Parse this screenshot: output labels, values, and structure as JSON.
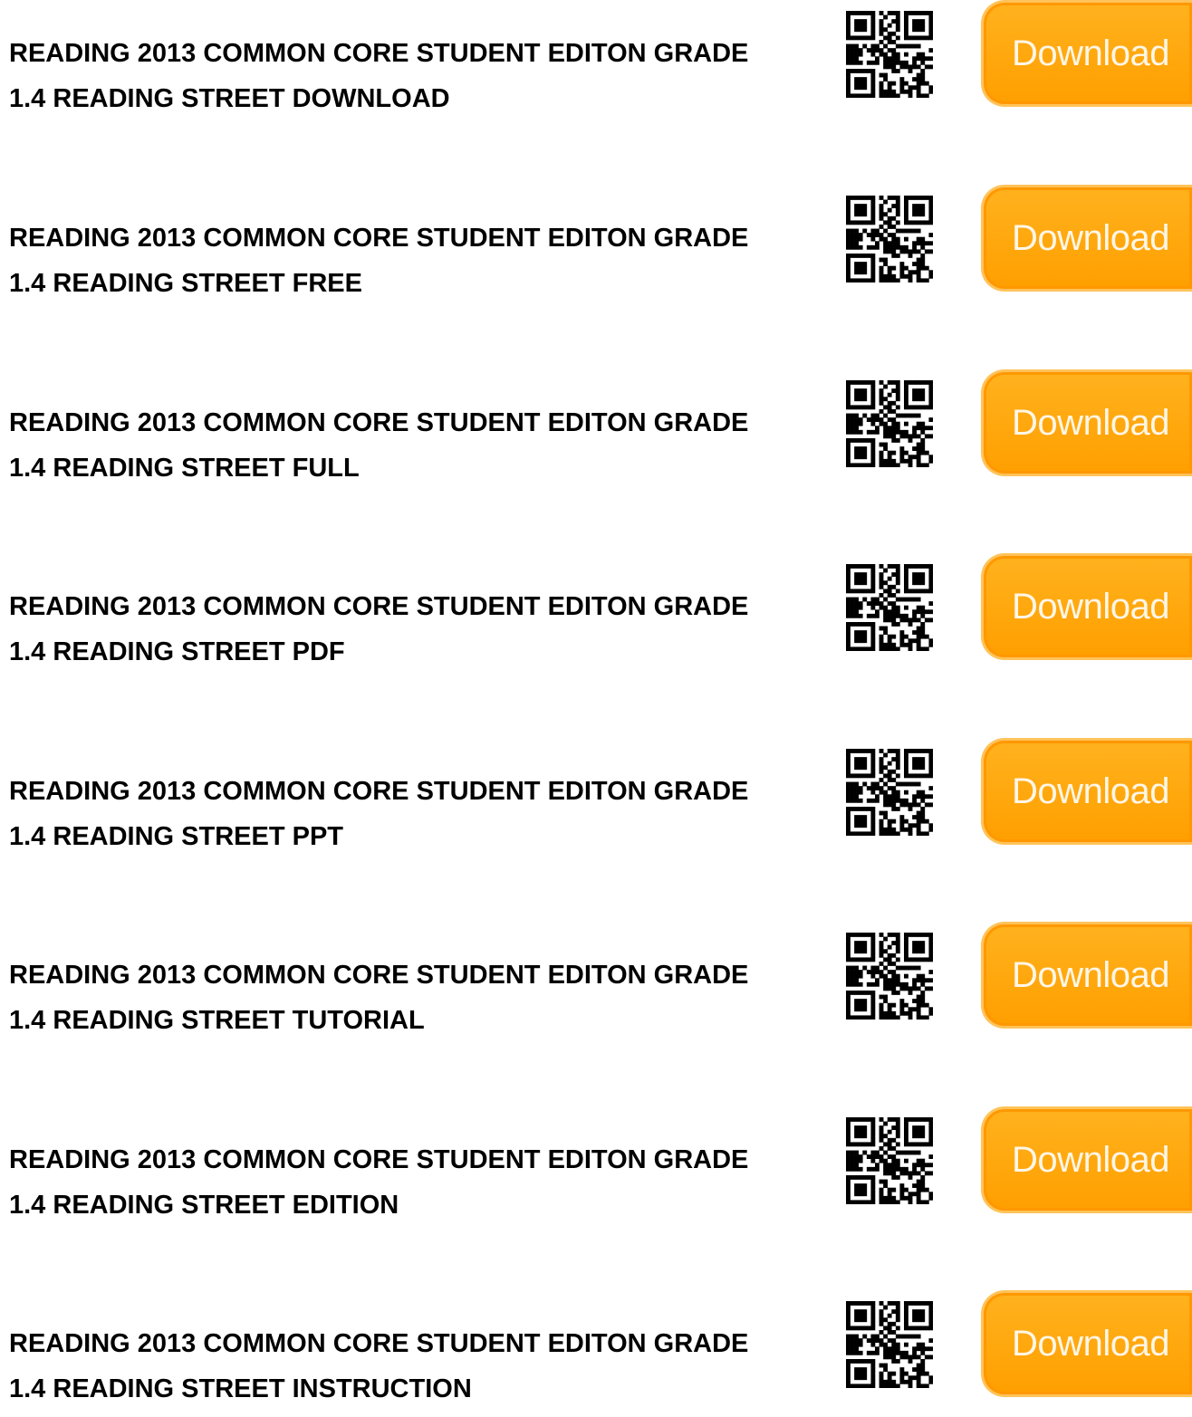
{
  "entries": [
    {
      "line1": "READING 2013 COMMON CORE STUDENT EDITON GRADE",
      "line2": "1.4 READING STREET DOWNLOAD",
      "button": "Download"
    },
    {
      "line1": "READING 2013 COMMON CORE STUDENT EDITON GRADE",
      "line2": "1.4 READING STREET FREE",
      "button": "Download"
    },
    {
      "line1": "READING 2013 COMMON CORE STUDENT EDITON GRADE",
      "line2": "1.4 READING STREET FULL",
      "button": "Download"
    },
    {
      "line1": "READING 2013 COMMON CORE STUDENT EDITON GRADE",
      "line2": "1.4 READING STREET PDF",
      "button": "Download"
    },
    {
      "line1": "READING 2013 COMMON CORE STUDENT EDITON GRADE",
      "line2": "1.4 READING STREET PPT",
      "button": "Download"
    },
    {
      "line1": "READING 2013 COMMON CORE STUDENT EDITON GRADE",
      "line2": "1.4 READING STREET TUTORIAL",
      "button": "Download"
    },
    {
      "line1": "READING 2013 COMMON CORE STUDENT EDITON GRADE",
      "line2": "1.4 READING STREET EDITION",
      "button": "Download"
    },
    {
      "line1": "READING 2013 COMMON CORE STUDENT EDITON GRADE",
      "line2": "1.4 READING STREET INSTRUCTION",
      "button": "Download"
    }
  ],
  "icons": {
    "qr": "qr-code-icon"
  },
  "colors": {
    "button": "#ff9f00",
    "button_text": "#fff6e6",
    "text": "#000000"
  }
}
